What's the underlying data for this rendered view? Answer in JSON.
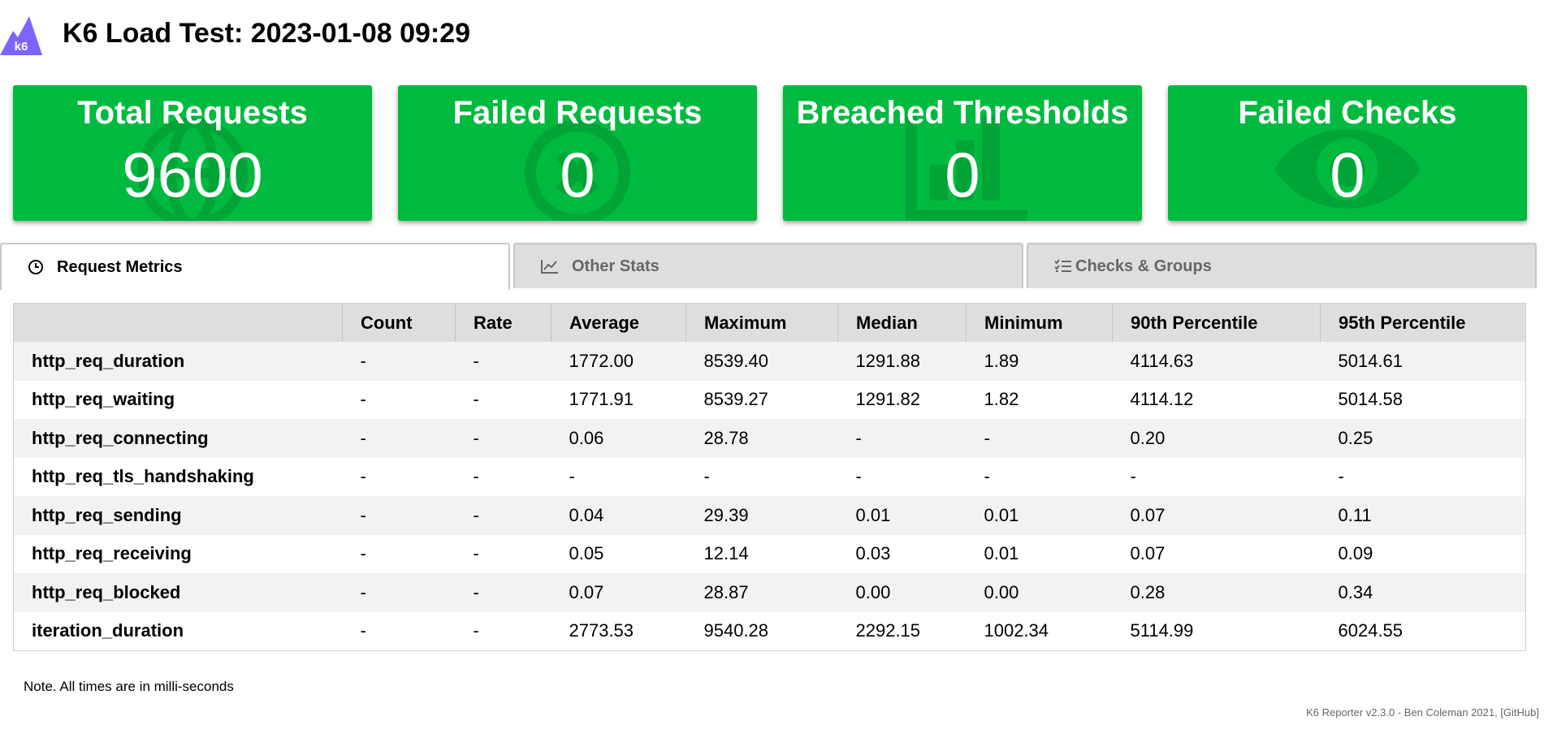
{
  "header": {
    "logo_text": "k6",
    "title": "K6 Load Test: 2023-01-08 09:29"
  },
  "stats": [
    {
      "title": "Total Requests",
      "value": "9600",
      "icon": "globe-icon"
    },
    {
      "title": "Failed Requests",
      "value": "0",
      "icon": "x-circle-icon"
    },
    {
      "title": "Breached Thresholds",
      "value": "0",
      "icon": "bar-chart-icon"
    },
    {
      "title": "Failed Checks",
      "value": "0",
      "icon": "eye-icon"
    }
  ],
  "tabs": [
    {
      "label": "Request Metrics",
      "icon": "clock-icon",
      "active": true
    },
    {
      "label": "Other Stats",
      "icon": "line-chart-icon",
      "active": false
    },
    {
      "label": "Checks & Groups",
      "icon": "checklist-icon",
      "active": false
    }
  ],
  "table": {
    "headers": [
      "",
      "Count",
      "Rate",
      "Average",
      "Maximum",
      "Median",
      "Minimum",
      "90th Percentile",
      "95th Percentile"
    ],
    "rows": [
      [
        "http_req_duration",
        "-",
        "-",
        "1772.00",
        "8539.40",
        "1291.88",
        "1.89",
        "4114.63",
        "5014.61"
      ],
      [
        "http_req_waiting",
        "-",
        "-",
        "1771.91",
        "8539.27",
        "1291.82",
        "1.82",
        "4114.12",
        "5014.58"
      ],
      [
        "http_req_connecting",
        "-",
        "-",
        "0.06",
        "28.78",
        "-",
        "-",
        "0.20",
        "0.25"
      ],
      [
        "http_req_tls_handshaking",
        "-",
        "-",
        "-",
        "-",
        "-",
        "-",
        "-",
        "-"
      ],
      [
        "http_req_sending",
        "-",
        "-",
        "0.04",
        "29.39",
        "0.01",
        "0.01",
        "0.07",
        "0.11"
      ],
      [
        "http_req_receiving",
        "-",
        "-",
        "0.05",
        "12.14",
        "0.03",
        "0.01",
        "0.07",
        "0.09"
      ],
      [
        "http_req_blocked",
        "-",
        "-",
        "0.07",
        "28.87",
        "0.00",
        "0.00",
        "0.28",
        "0.34"
      ],
      [
        "iteration_duration",
        "-",
        "-",
        "2773.53",
        "9540.28",
        "2292.15",
        "1002.34",
        "5114.99",
        "6024.55"
      ]
    ]
  },
  "note": "Note. All times are in milli-seconds",
  "footer": {
    "text": "K6 Reporter v2.3.0 - Ben Coleman 2021, ",
    "link": "[GitHub]"
  },
  "colors": {
    "stat_green": "#00ba3f",
    "logo_purple": "#7d64ff"
  }
}
